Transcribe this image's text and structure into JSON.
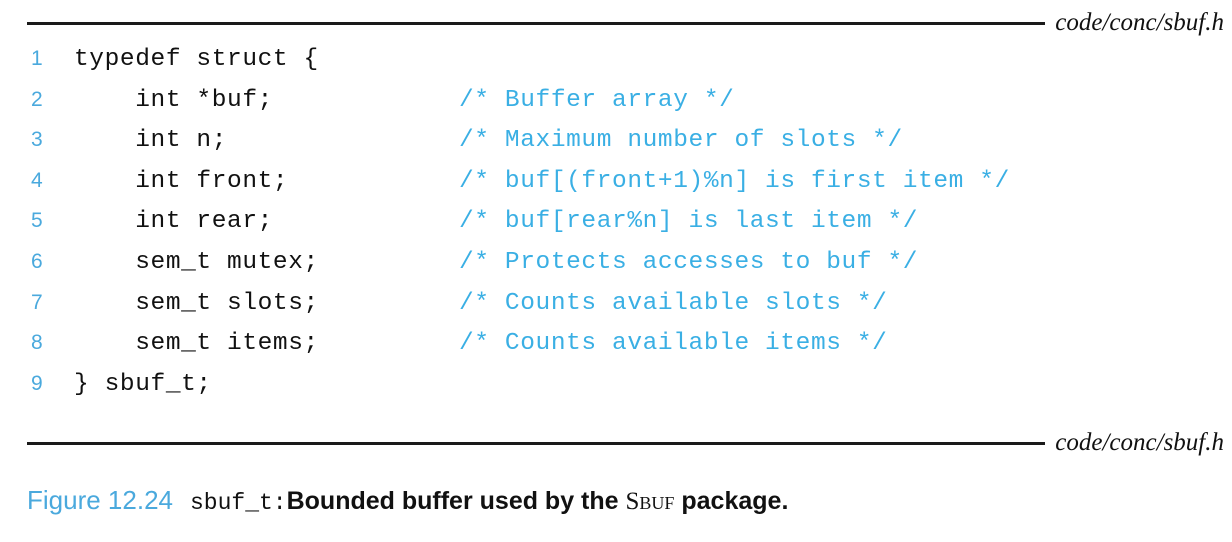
{
  "header": {
    "file_label": "code/conc/sbuf.h"
  },
  "footer": {
    "file_label": "code/conc/sbuf.h"
  },
  "code": {
    "language": "c",
    "lines": [
      {
        "num": "1",
        "text": "typedef struct {",
        "comment": ""
      },
      {
        "num": "2",
        "text": "    int *buf;",
        "comment": "/* Buffer array */"
      },
      {
        "num": "3",
        "text": "    int n;",
        "comment": "/* Maximum number of slots */"
      },
      {
        "num": "4",
        "text": "    int front;",
        "comment": "/* buf[(front+1)%n] is first item */"
      },
      {
        "num": "5",
        "text": "    int rear;",
        "comment": "/* buf[rear%n] is last item */"
      },
      {
        "num": "6",
        "text": "    sem_t mutex;",
        "comment": "/* Protects accesses to buf */"
      },
      {
        "num": "7",
        "text": "    sem_t slots;",
        "comment": "/* Counts available slots */"
      },
      {
        "num": "8",
        "text": "    sem_t items;",
        "comment": "/* Counts available items */"
      },
      {
        "num": "9",
        "text": "} sbuf_t;",
        "comment": ""
      }
    ]
  },
  "caption": {
    "label": "Figure 12.24",
    "type_name": "sbuf_t:",
    "text_before": "Bounded buffer used by the ",
    "small_caps": "Sbuf",
    "text_after": " package."
  },
  "colors": {
    "accent_blue": "#3aafe4",
    "lineno_blue": "#4aa9dd",
    "text_black": "#111111",
    "rule": "#1a1a1a",
    "background": "#ffffff"
  }
}
